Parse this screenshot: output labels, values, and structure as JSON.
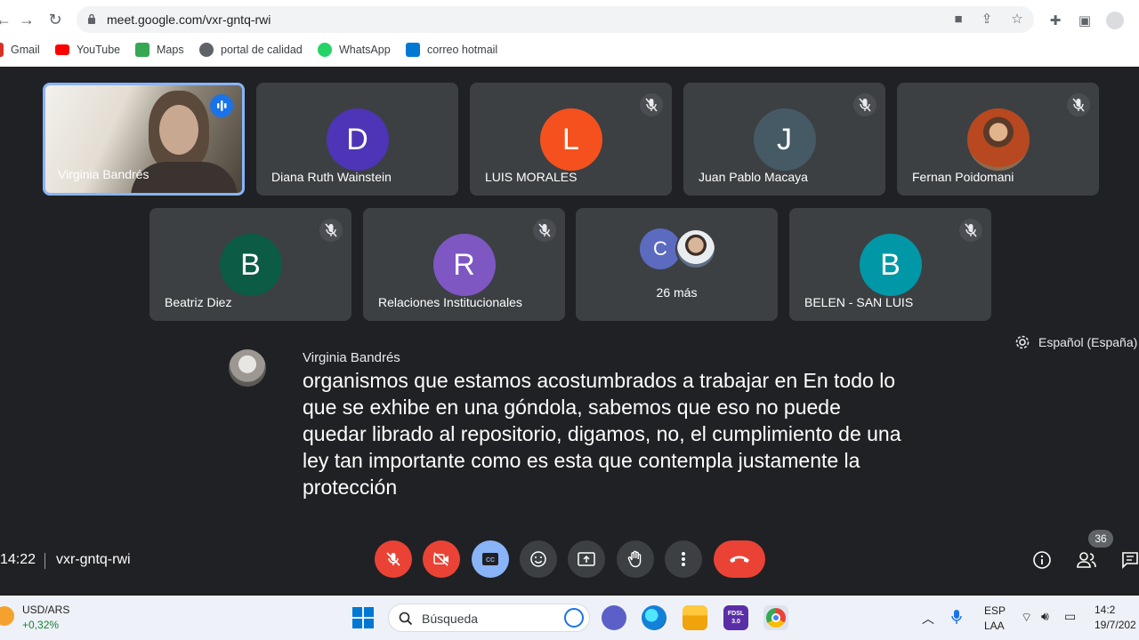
{
  "browser": {
    "url": "meet.google.com/vxr-gntq-rwi",
    "bookmarks": [
      {
        "label": "Gmail",
        "color": "#d93025"
      },
      {
        "label": "YouTube",
        "color": "#ff0000"
      },
      {
        "label": "Maps",
        "color": "#34a853"
      },
      {
        "label": "portal de calidad",
        "color": "#5f6368"
      },
      {
        "label": "WhatsApp",
        "color": "#25d366"
      },
      {
        "label": "correo hotmail",
        "color": "#0078d4"
      }
    ]
  },
  "participants": {
    "row1": [
      {
        "name": "Virginia Bandrés",
        "type": "video"
      },
      {
        "name": "Diana Ruth Wainstein",
        "initial": "D",
        "color": "#4e34b6"
      },
      {
        "name": "LUIS MORALES",
        "initial": "L",
        "color": "#f4511e"
      },
      {
        "name": "Juan Pablo Macaya",
        "initial": "J",
        "color": "#455a64"
      },
      {
        "name": "Fernan Poidomani",
        "type": "photo"
      }
    ],
    "row2": [
      {
        "name": "Beatriz Diez",
        "initial": "B",
        "color": "#0b5b45"
      },
      {
        "name": "Relaciones Institucionales",
        "initial": "R",
        "color": "#7e57c2"
      },
      {
        "name": "26 más",
        "initial": "C",
        "color": "#5c6bc0"
      },
      {
        "name": "BELEN - SAN LUIS",
        "initial": "B",
        "color": "#0097a7"
      }
    ]
  },
  "captions": {
    "speaker": "Virginia Bandrés",
    "text": "organismos que estamos acostumbrados a trabajar en En todo lo que se exhibe en una góndola, sabemos que eso no puede quedar librado al repositorio, digamos, no, el cumplimiento de una ley tan importante como es esta que contempla justamente la protección",
    "language": "Español (España)"
  },
  "meeting": {
    "time": "14:22",
    "code": "vxr-gntq-rwi",
    "participant_count": "36"
  },
  "taskbar": {
    "ticker_name": "USD/ARS",
    "ticker_value": "+0,32%",
    "search_label": "Búsqueda",
    "app_label": "FDSL 3.0",
    "lang1": "ESP",
    "lang2": "LAA",
    "clock_time": "14:2",
    "clock_date": "19/7/202"
  }
}
